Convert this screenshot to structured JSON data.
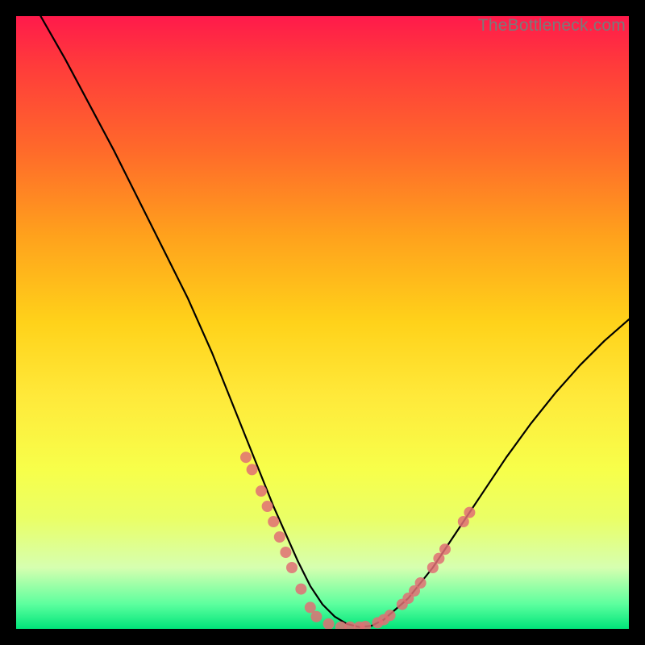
{
  "watermark": "TheBottleneck.com",
  "chart_data": {
    "type": "line",
    "title": "",
    "xlabel": "",
    "ylabel": "",
    "xlim": [
      0,
      100
    ],
    "ylim": [
      0,
      100
    ],
    "grid": false,
    "legend": false,
    "series": [
      {
        "name": "curve",
        "x": [
          4,
          8,
          12,
          16,
          20,
          24,
          28,
          32,
          34,
          36,
          38,
          40,
          42,
          44,
          46,
          48,
          50,
          52,
          54,
          56,
          58,
          60,
          64,
          68,
          72,
          76,
          80,
          84,
          88,
          92,
          96,
          100
        ],
        "y": [
          100,
          93,
          85.5,
          78,
          70,
          62,
          54,
          45,
          40,
          35,
          30,
          25,
          20,
          15.5,
          11,
          7,
          4,
          2,
          0.8,
          0.3,
          0.5,
          1.5,
          5,
          10,
          16,
          22,
          28,
          33.5,
          38.5,
          43,
          47,
          50.5
        ]
      }
    ],
    "markers": [
      {
        "x": 37.5,
        "y": 28
      },
      {
        "x": 38.5,
        "y": 26
      },
      {
        "x": 40,
        "y": 22.5
      },
      {
        "x": 41,
        "y": 20
      },
      {
        "x": 42,
        "y": 17.5
      },
      {
        "x": 43,
        "y": 15
      },
      {
        "x": 44,
        "y": 12.5
      },
      {
        "x": 45,
        "y": 10
      },
      {
        "x": 46.5,
        "y": 6.5
      },
      {
        "x": 48,
        "y": 3.5
      },
      {
        "x": 49,
        "y": 2
      },
      {
        "x": 51,
        "y": 0.8
      },
      {
        "x": 53,
        "y": 0.3
      },
      {
        "x": 54.5,
        "y": 0.3
      },
      {
        "x": 56,
        "y": 0.3
      },
      {
        "x": 57,
        "y": 0.4
      },
      {
        "x": 59,
        "y": 1
      },
      {
        "x": 60,
        "y": 1.5
      },
      {
        "x": 61,
        "y": 2.2
      },
      {
        "x": 63,
        "y": 4
      },
      {
        "x": 64,
        "y": 5
      },
      {
        "x": 65,
        "y": 6.2
      },
      {
        "x": 66,
        "y": 7.5
      },
      {
        "x": 68,
        "y": 10
      },
      {
        "x": 69,
        "y": 11.5
      },
      {
        "x": 70,
        "y": 13
      },
      {
        "x": 73,
        "y": 17.5
      },
      {
        "x": 74,
        "y": 19
      }
    ],
    "background_gradient": {
      "top": "#ff1a4b",
      "bottom": "#00e47a"
    },
    "marker_color": "#e06f74",
    "curve_color": "#000000"
  }
}
